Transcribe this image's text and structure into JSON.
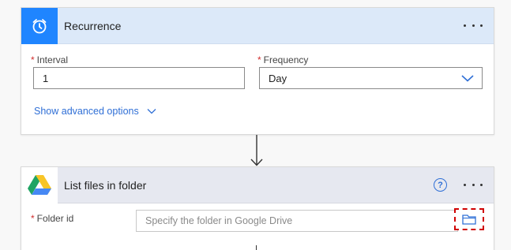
{
  "recurrence": {
    "title": "Recurrence",
    "interval_label": "Interval",
    "interval_value": "1",
    "frequency_label": "Frequency",
    "frequency_value": "Day",
    "advanced_label": "Show advanced options",
    "required_mark": "*"
  },
  "drive": {
    "title": "List files in folder",
    "folder_label": "Folder id",
    "folder_placeholder": "Specify the folder in Google Drive",
    "required_mark": "*",
    "help_glyph": "?"
  },
  "icons": {
    "recurrence_icon": "alarm-clock-icon",
    "drive_icon": "google-drive-icon",
    "folder_picker_icon": "folder-icon",
    "more_icon": "more-dots-icon",
    "help_icon": "help-circle-icon",
    "chevron_icon": "chevron-down-icon"
  },
  "colors": {
    "accent_blue": "#1f85ff",
    "link_blue": "#2f6fd6",
    "required_red": "#d12d2d",
    "highlight_red": "#d00000"
  }
}
